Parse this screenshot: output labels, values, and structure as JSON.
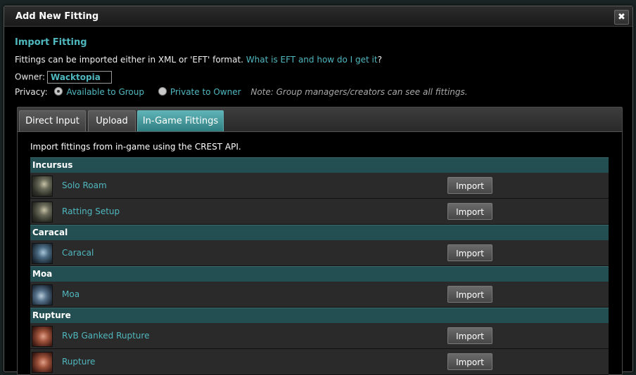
{
  "dialog": {
    "title": "Add New Fitting",
    "close_glyph": "✖"
  },
  "import": {
    "heading": "Import Fitting",
    "description_prefix": "Fittings can be imported either in XML or 'EFT' format. ",
    "eft_link": "What is EFT and how do I get it",
    "description_suffix": "?"
  },
  "owner": {
    "label": "Owner:",
    "value": "Wacktopia"
  },
  "privacy": {
    "label": "Privacy:",
    "option_group": "Available to Group",
    "option_owner": "Private to Owner",
    "selected": "Available to Group",
    "note": "Note: Group managers/creators can see all fittings."
  },
  "tabs": [
    {
      "label": "Direct Input",
      "active": false
    },
    {
      "label": "Upload",
      "active": false
    },
    {
      "label": "In-Game Fittings",
      "active": true
    }
  ],
  "ingame": {
    "intro": "Import fittings from in-game using the CREST API.",
    "import_label": "Import",
    "groups": [
      {
        "ship": "Incursus",
        "fittings": [
          "Solo Roam",
          "Ratting Setup"
        ]
      },
      {
        "ship": "Caracal",
        "fittings": [
          "Caracal"
        ]
      },
      {
        "ship": "Moa",
        "fittings": [
          "Moa"
        ]
      },
      {
        "ship": "Rupture",
        "fittings": [
          "RvB Ganked Rupture",
          "Rupture"
        ]
      }
    ]
  },
  "colors": {
    "accent": "#4fb8bf",
    "group_header_bg": "#234f52",
    "active_tab": "#3f9ea2"
  }
}
